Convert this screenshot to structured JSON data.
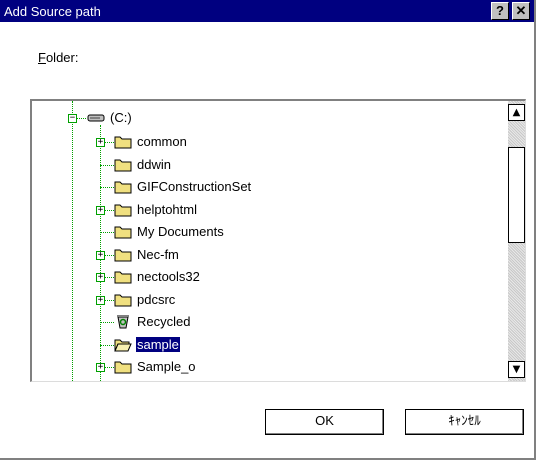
{
  "dialog": {
    "title": "Add Source path",
    "help_button": "?",
    "close_button": "✕"
  },
  "folder_label_underlined": "F",
  "folder_label_rest": "older:",
  "tree": {
    "root": {
      "label": "(C:)",
      "icon": "drive-icon",
      "expanded": true
    },
    "items": [
      {
        "label": "common",
        "icon": "folder-icon",
        "has_children": true,
        "selected": false
      },
      {
        "label": "ddwin",
        "icon": "folder-icon",
        "has_children": false,
        "selected": false
      },
      {
        "label": "GIFConstructionSet",
        "icon": "folder-icon",
        "has_children": false,
        "selected": false
      },
      {
        "label": "helptohtml",
        "icon": "folder-icon",
        "has_children": true,
        "selected": false
      },
      {
        "label": "My Documents",
        "icon": "folder-icon",
        "has_children": false,
        "selected": false
      },
      {
        "label": "Nec-fm",
        "icon": "folder-icon",
        "has_children": true,
        "selected": false
      },
      {
        "label": "nectools32",
        "icon": "folder-icon",
        "has_children": true,
        "selected": false
      },
      {
        "label": "pdcsrc",
        "icon": "folder-icon",
        "has_children": true,
        "selected": false
      },
      {
        "label": "Recycled",
        "icon": "recycle-bin-icon",
        "has_children": false,
        "selected": false
      },
      {
        "label": "sample",
        "icon": "open-folder-icon",
        "has_children": false,
        "selected": true
      },
      {
        "label": "Sample_o",
        "icon": "folder-icon",
        "has_children": true,
        "selected": false
      }
    ]
  },
  "scrollbar": {
    "up_arrow": "▲",
    "down_arrow": "▼"
  },
  "buttons": {
    "ok": "OK",
    "cancel": "ｷｬﾝｾﾙ"
  },
  "colors": {
    "titlebar": "#000080",
    "tree_lines": "#00a000",
    "selection": "#000080",
    "folder": "#f0e080"
  }
}
